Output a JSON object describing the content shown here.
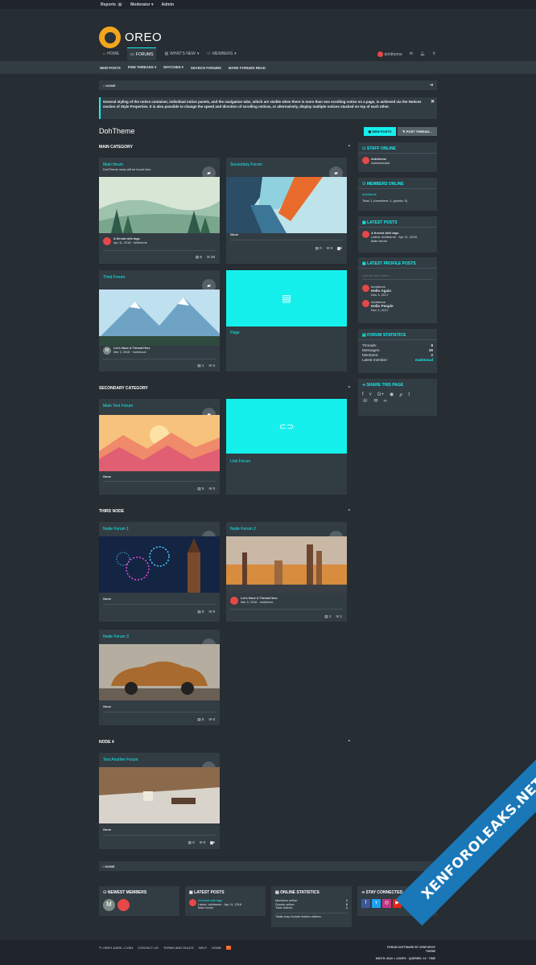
{
  "topbar": {
    "reports": "Reports",
    "reports_count": "5",
    "moderator": "Moderator",
    "admin": "Admin"
  },
  "brand": {
    "name": "OREO"
  },
  "nav": {
    "home": "HOME",
    "forums": "FORUMS",
    "whats_new": "WHAT'S NEW",
    "members": "MEMBERS",
    "user": "dohtheme"
  },
  "subnav": [
    "NEW POSTS",
    "FIND THREADS",
    "WATCHED",
    "SEARCH FORUMS",
    "MARK FORUMS READ"
  ],
  "breadcrumb": {
    "home": "HOME"
  },
  "notice": {
    "text": "General styling of the notice container, individual notice panels, and the navigation tabs, which are visible when there is more than one scrolling notice on a page, is achieved via the Notices section of Style Properties. It is also possible to change the speed and direction of scrolling notices, or alternatively, display multiple notices stacked on top of each other."
  },
  "page": {
    "title": "DohTheme",
    "new_posts": "NEW POSTS",
    "post_thread": "POST THREAD..."
  },
  "categories": {
    "main": "MAIN CATEGORY",
    "secondary": "SECONDARY CATEGORY",
    "third": "THIRD NODE",
    "node4": "NODE 4"
  },
  "forums": {
    "main": {
      "title": "Main forum",
      "desc": "DohTheme news will be found here",
      "last_title": "A thread with tags",
      "last_meta": "Apr 11, 2018 · dohtheme",
      "threads": "6",
      "messages": "26"
    },
    "secondary": {
      "title": "Secondary Forum",
      "none": "None",
      "threads": "0",
      "messages": "0"
    },
    "third": {
      "title": "Third Forum",
      "last_title": "Let's Have A Thread Here",
      "last_meta": "Mar 3, 2018 · mahmoud",
      "threads": "1",
      "messages": "2",
      "avatar": "M"
    },
    "page": {
      "title": "Page"
    },
    "maintest": {
      "title": "Main Test Forum",
      "none": "None",
      "threads": "0",
      "messages": "0"
    },
    "link": {
      "title": "Link Forum"
    },
    "node1": {
      "title": "Node Forum 1",
      "none": "None",
      "threads": "0",
      "messages": "0"
    },
    "node2": {
      "title": "Node Forum 2",
      "last_title": "Let's Have A Thread Here",
      "last_meta": "Mar 5, 2018 · dohtheme",
      "threads": "1",
      "messages": "1"
    },
    "node3": {
      "title": "Node Forum 3",
      "none": "None",
      "threads": "0",
      "messages": "0"
    },
    "another": {
      "title": "Test Another Forum",
      "none": "None",
      "threads": "0",
      "messages": "0"
    }
  },
  "sidebar": {
    "staff": {
      "title": "STAFF ONLINE",
      "name": "dohtheme",
      "role": "Administrator"
    },
    "members": {
      "title": "MEMBERS ONLINE",
      "name": "dohtheme",
      "total": "Total: 1 (members: 1, guests: 0)"
    },
    "latest": {
      "title": "LATEST POSTS",
      "post": "A thread with tags",
      "meta": "Latest: dohtheme · Apr 11, 2018",
      "forum": "Main forum"
    },
    "profile": {
      "title": "LATEST PROFILE POSTS",
      "placeholder": "Update your status...",
      "p1_user": "dohtheme",
      "p1_text": "Hello Again",
      "p1_date": "Dec 3, 2017",
      "p2_user": "dohtheme",
      "p2_text": "Hello People",
      "p2_date": "Dec 3, 2017"
    },
    "stats": {
      "title": "FORUM STATISTICS",
      "threads_l": "Threads:",
      "threads": "8",
      "messages_l": "Messages:",
      "messages": "29",
      "members_l": "Members:",
      "members": "2",
      "latest_l": "Latest member:",
      "latest": "mahmoud"
    },
    "share": {
      "title": "SHARE THIS PAGE"
    }
  },
  "bottom": {
    "newest": "NEWEST MEMBERS",
    "newest_avatar": "M",
    "latest": "LATEST POSTS",
    "latest_post": "A thread with tags",
    "latest_meta": "Latest: dohtheme · Apr 11, 2018",
    "latest_forum": "Main forum",
    "online": "ONLINE STATISTICS",
    "members_l": "Members online:",
    "members": "1",
    "guests_l": "Guests online:",
    "guests": "0",
    "visitors_l": "Total visitors:",
    "visitors": "1",
    "hidden": "Totals may include hidden visitors.",
    "connected": "STAY CONNECTED"
  },
  "footer": {
    "style": "OREO-DARK--CYAN",
    "contact": "CONTACT US",
    "terms": "TERMS AND RULES",
    "help": "HELP",
    "home": "HOME",
    "software": "FORUM SOFTWARE BY XENFORO®",
    "theme": "THEME",
    "width": "WIDTH: MAX > 1200PX · QUERIES: 19 · TIME"
  },
  "watermark": "XENFOROLEAKS.NET",
  "colors": {
    "accent": "#15f0ed",
    "bg": "#262d33",
    "panel": "#323c43"
  }
}
